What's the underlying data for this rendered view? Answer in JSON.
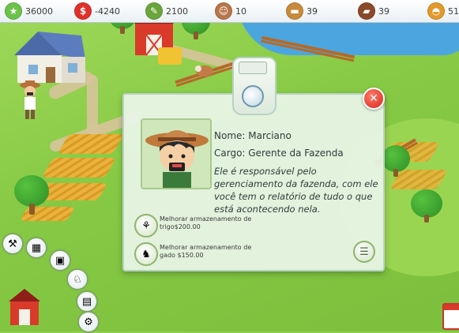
{
  "resources": [
    {
      "name": "xp",
      "icon": "star-icon",
      "symbol": "★",
      "color": "#6cc24a",
      "value": "36000"
    },
    {
      "name": "money",
      "icon": "dollar-icon",
      "symbol": "$",
      "color": "#e0302a",
      "value": "-4240"
    },
    {
      "name": "feed",
      "icon": "seed-icon",
      "symbol": "✎",
      "color": "#6aa63a",
      "value": "2100"
    },
    {
      "name": "workers",
      "icon": "farmer-icon",
      "symbol": "☺",
      "color": "#b8764a",
      "value": "10"
    },
    {
      "name": "food",
      "icon": "bread-icon",
      "symbol": "▬",
      "color": "#c88a3a",
      "value": "39"
    },
    {
      "name": "meat",
      "icon": "meat-icon",
      "symbol": "▰",
      "color": "#8a4a2a",
      "value": "39"
    },
    {
      "name": "burger",
      "icon": "burger-icon",
      "symbol": "◓",
      "color": "#e39a2a",
      "value": "51"
    }
  ],
  "dialog": {
    "name_line": "Nome: Marciano",
    "role_line": "Cargo: Gerente da Fazenda",
    "description": "Ele é responsável pelo gerenciamento da fazenda, com ele você tem o relatório de tudo o que está acontecendo nela.",
    "upgrades": [
      {
        "line1": "Melhorar armazenamento de",
        "line2": "trigo$200.00",
        "icon": "wheat-icon",
        "symbol": "⚘"
      },
      {
        "line1": "Melhorar armazenamento de",
        "line2": "gado $150.00",
        "icon": "cow-icon",
        "symbol": "♞"
      }
    ],
    "close_symbol": "✕",
    "list_symbol": "☰"
  },
  "tools": [
    {
      "name": "tool-build-icon",
      "symbol": "⚒"
    },
    {
      "name": "tool-field-icon",
      "symbol": "▦"
    },
    {
      "name": "tool-crate-icon",
      "symbol": "▣"
    },
    {
      "name": "tool-animal-icon",
      "symbol": "♘"
    },
    {
      "name": "tool-book-icon",
      "symbol": "▤"
    },
    {
      "name": "tool-settings-icon",
      "symbol": "⚙"
    }
  ]
}
